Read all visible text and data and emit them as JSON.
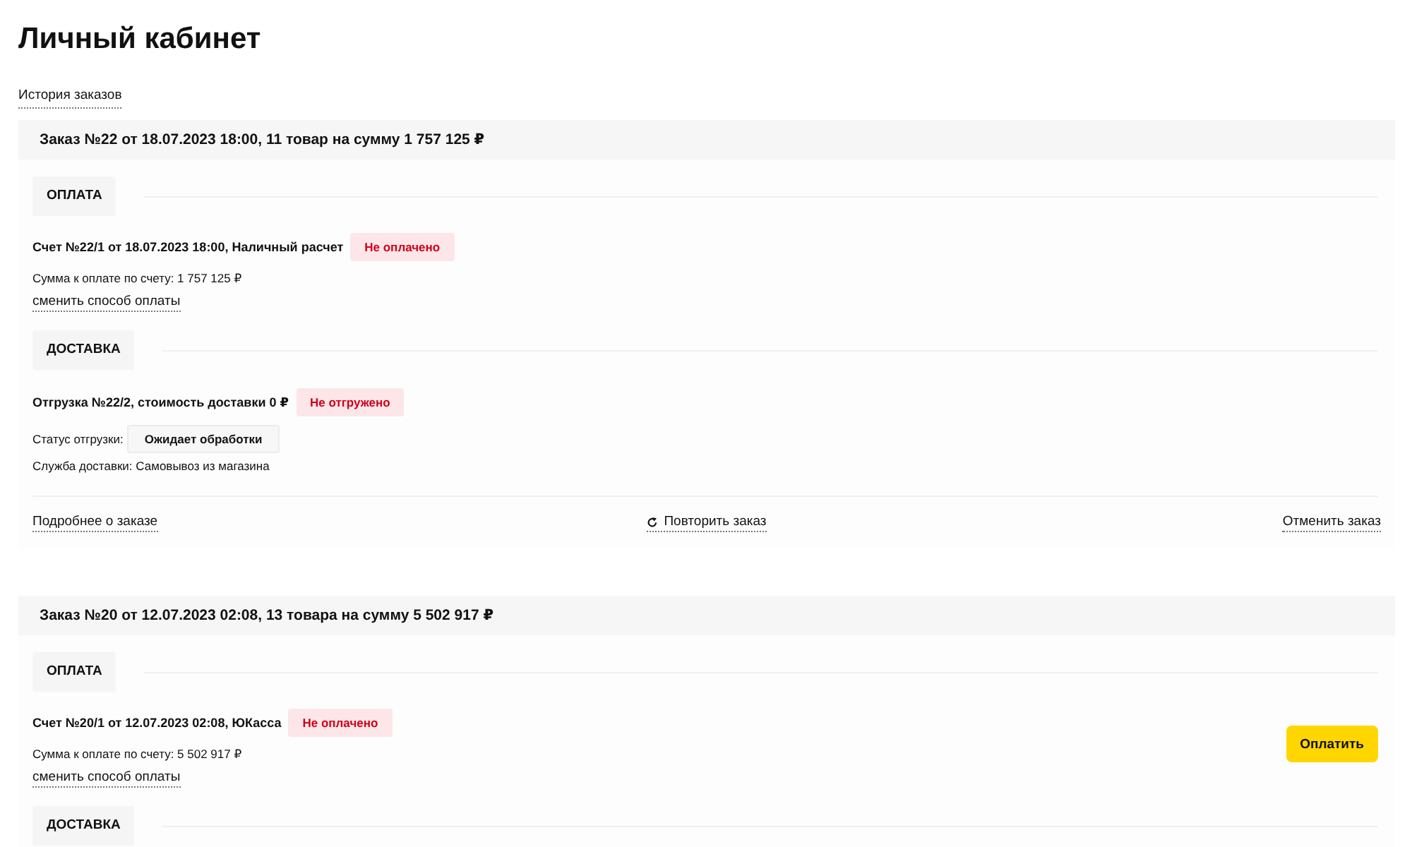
{
  "page_title": "Личный кабинет",
  "history_link": "История заказов",
  "orders": [
    {
      "header": "Заказ №22 от 18.07.2023 18:00, 11 товар на сумму 1 757 125 ₽",
      "sections": [
        {
          "kind": "payment",
          "label": "ОПЛАТА",
          "title": "Счет №22/1 от 18.07.2023 18:00, Наличный расчет",
          "status": "Не оплачено",
          "amount": "Сумма к оплате по счету: 1 757 125 ₽",
          "change_link": "сменить способ оплаты"
        },
        {
          "kind": "delivery",
          "label": "ДОСТАВКА",
          "title": "Отгрузка №22/2, стоимость доставки 0 ₽",
          "status": "Не отгружено",
          "shipment_status_label": "Статус отгрузки:",
          "shipment_status": "Ожидает обработки",
          "service": "Служба доставки: Самовывоз из магазина"
        }
      ],
      "footer": {
        "details_link": "Подробнее о заказе",
        "repeat_link": "Повторить заказ",
        "cancel_link": "Отменить заказ"
      }
    },
    {
      "header": "Заказ №20 от 12.07.2023 02:08, 13 товара на сумму 5 502 917 ₽",
      "sections": [
        {
          "kind": "payment",
          "label": "ОПЛАТА",
          "title": "Счет №20/1 от 12.07.2023 02:08, ЮКасса",
          "status": "Не оплачено",
          "amount": "Сумма к оплате по счету: 5 502 917 ₽",
          "change_link": "сменить способ оплаты",
          "pay_button": "Оплатить"
        },
        {
          "kind": "delivery",
          "label": "ДОСТАВКА"
        }
      ]
    }
  ]
}
